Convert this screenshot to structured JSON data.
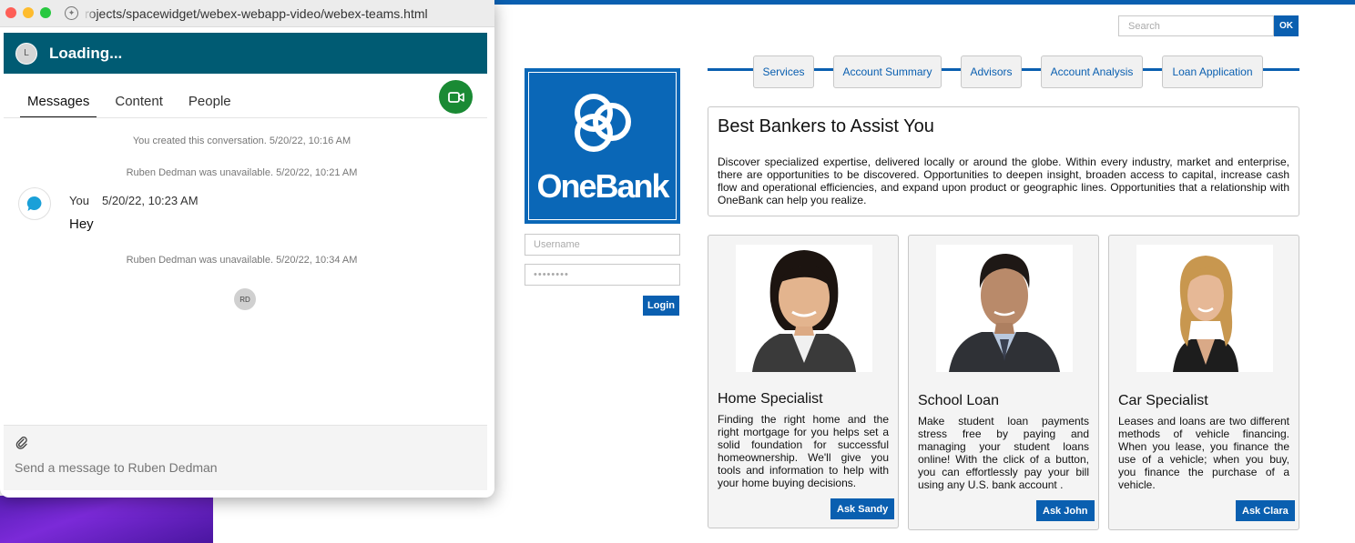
{
  "browser": {
    "url": "rojects/spacewidget/webex-webapp-video/webex-teams.html"
  },
  "chat": {
    "avatar_initial": "L",
    "title": "Loading...",
    "tabs": [
      "Messages",
      "Content",
      "People"
    ],
    "system_messages": [
      "You created this conversation. 5/20/22, 10:16 AM",
      "Ruben Dedman was unavailable. 5/20/22, 10:21 AM",
      "Ruben Dedman was unavailable. 5/20/22, 10:34 AM"
    ],
    "message": {
      "sender": "You",
      "time": "5/20/22, 10:23 AM",
      "text": "Hey"
    },
    "read_receipt_initials": "RD",
    "composer_placeholder": "Send a message to Ruben Dedman"
  },
  "bank": {
    "search_placeholder": "Search",
    "search_button": "OK",
    "logo_text": "OneBank",
    "username_placeholder": "Username",
    "password_value": "••••••••",
    "login_label": "Login",
    "nav": [
      "Services",
      "Account Summary",
      "Advisors",
      "Account Analysis",
      "Loan Application"
    ],
    "intro_title": "Best Bankers to Assist You",
    "intro_text": "Discover specialized expertise, delivered locally or around the globe. Within every industry, market and enterprise, there are opportunities to be discovered. Opportunities to deepen insight, broaden access to capital, increase cash flow and operational efficiencies, and expand upon product or geographic lines. Opportunities that a relationship with OneBank can help you realize.",
    "cards": [
      {
        "title": "Home Specialist",
        "text": "Finding the right home and the right mortgage for you helps set a solid foundation for successful homeownership. We'll give you tools and information to help with your home buying decisions.",
        "button": "Ask Sandy"
      },
      {
        "title": "School Loan",
        "text": "Make student loan payments stress free by paying and managing your student loans online! With the click of a button, you can effortlessly pay your bill using any U.S. bank account .",
        "button": "Ask John"
      },
      {
        "title": "Car Specialist",
        "text": "Leases and loans are two different methods of vehicle financing. When you lease, you finance the use of a vehicle; when you buy, you finance the purchase of a vehicle.",
        "button": "Ask Clara"
      }
    ]
  },
  "colors": {
    "bank_blue": "#0a5fb0",
    "chat_header": "#005b73",
    "video_green": "#1a8a34"
  }
}
